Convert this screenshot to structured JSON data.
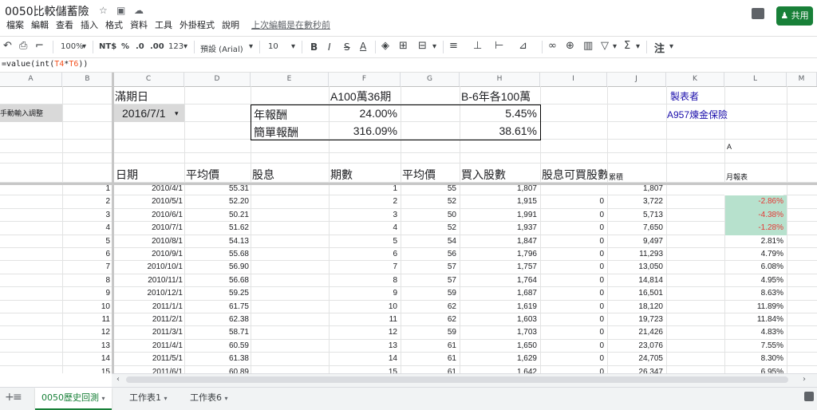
{
  "title_bar": {
    "doc_title": "0050比較儲蓄險",
    "menus": [
      "檔案",
      "編輯",
      "查看",
      "插入",
      "格式",
      "資料",
      "工具",
      "外掛程式",
      "說明"
    ],
    "last_edit": "上次編輯是在數秒前",
    "share_label": "共用",
    "share_icon": "person-icon"
  },
  "toolbar": {
    "zoom": "100%",
    "currency": "NT$",
    "percent": "%",
    "dec_decrease": ".0",
    "dec_increase": ".00",
    "more_formats": "123",
    "font": "預設 (Arial)",
    "font_size": "10",
    "bold": "B",
    "italic": "I",
    "strike": "S",
    "text_color": "A",
    "sigma": "Σ",
    "note": "注"
  },
  "formula_bar": {
    "before": "=value(int(",
    "ref1": "T4",
    "mid": "*",
    "ref2": "T6",
    "after": "))"
  },
  "columns": [
    "A",
    "B",
    "C",
    "D",
    "E",
    "F",
    "G",
    "H",
    "I",
    "J",
    "K",
    "L",
    "M"
  ],
  "sheet": {
    "b1": "滿期日",
    "a2": "手動輸入調整",
    "b2": "2016/7/1",
    "e1": "A100萬36期",
    "g1": "B-6年各100萬",
    "j1": "製表者",
    "j2": "A957煉金保險",
    "d2": "年報酬",
    "f2": "24.00%",
    "h2": "5.45%",
    "d3": "簡單報酬",
    "f3": "316.09%",
    "h3": "38.61%",
    "l4": "A",
    "headers": {
      "date": "日期",
      "avg_price": "平均價",
      "dividend": "股息",
      "periods": "期數",
      "avg_price2": "平均價",
      "buy_shares": "買入股數",
      "div_shares": "股息可買股數",
      "cumulative": "累積",
      "monthly": "月報表"
    }
  },
  "rows": [
    {
      "n": "1",
      "date": "2010/4/1",
      "avg": "55.31",
      "periods": "1",
      "avg2": "55",
      "buy": "1,807",
      "div": "",
      "cum": "1,807",
      "monthly": ""
    },
    {
      "n": "2",
      "date": "2010/5/1",
      "avg": "52.20",
      "periods": "2",
      "avg2": "52",
      "buy": "1,915",
      "div": "0",
      "cum": "3,722",
      "monthly": "-2.86%"
    },
    {
      "n": "3",
      "date": "2010/6/1",
      "avg": "50.21",
      "periods": "3",
      "avg2": "50",
      "buy": "1,991",
      "div": "0",
      "cum": "5,713",
      "monthly": "-4.38%"
    },
    {
      "n": "4",
      "date": "2010/7/1",
      "avg": "51.62",
      "periods": "4",
      "avg2": "52",
      "buy": "1,937",
      "div": "0",
      "cum": "7,650",
      "monthly": "-1.28%"
    },
    {
      "n": "5",
      "date": "2010/8/1",
      "avg": "54.13",
      "periods": "5",
      "avg2": "54",
      "buy": "1,847",
      "div": "0",
      "cum": "9,497",
      "monthly": "2.81%"
    },
    {
      "n": "6",
      "date": "2010/9/1",
      "avg": "55.68",
      "periods": "6",
      "avg2": "56",
      "buy": "1,796",
      "div": "0",
      "cum": "11,293",
      "monthly": "4.79%"
    },
    {
      "n": "7",
      "date": "2010/10/1",
      "avg": "56.90",
      "periods": "7",
      "avg2": "57",
      "buy": "1,757",
      "div": "0",
      "cum": "13,050",
      "monthly": "6.08%"
    },
    {
      "n": "8",
      "date": "2010/11/1",
      "avg": "56.68",
      "periods": "8",
      "avg2": "57",
      "buy": "1,764",
      "div": "0",
      "cum": "14,814",
      "monthly": "4.95%"
    },
    {
      "n": "9",
      "date": "2010/12/1",
      "avg": "59.25",
      "periods": "9",
      "avg2": "59",
      "buy": "1,687",
      "div": "0",
      "cum": "16,501",
      "monthly": "8.63%"
    },
    {
      "n": "10",
      "date": "2011/1/1",
      "avg": "61.75",
      "periods": "10",
      "avg2": "62",
      "buy": "1,619",
      "div": "0",
      "cum": "18,120",
      "monthly": "11.89%"
    },
    {
      "n": "11",
      "date": "2011/2/1",
      "avg": "62.38",
      "periods": "11",
      "avg2": "62",
      "buy": "1,603",
      "div": "0",
      "cum": "19,723",
      "monthly": "11.84%"
    },
    {
      "n": "12",
      "date": "2011/3/1",
      "avg": "58.71",
      "periods": "12",
      "avg2": "59",
      "buy": "1,703",
      "div": "0",
      "cum": "21,426",
      "monthly": "4.83%"
    },
    {
      "n": "13",
      "date": "2011/4/1",
      "avg": "60.59",
      "periods": "13",
      "avg2": "61",
      "buy": "1,650",
      "div": "0",
      "cum": "23,076",
      "monthly": "7.55%"
    },
    {
      "n": "14",
      "date": "2011/5/1",
      "avg": "61.38",
      "periods": "14",
      "avg2": "61",
      "buy": "1,629",
      "div": "0",
      "cum": "24,705",
      "monthly": "8.30%"
    },
    {
      "n": "15",
      "date": "2011/6/1",
      "avg": "60.89",
      "periods": "15",
      "avg2": "61",
      "buy": "1,642",
      "div": "0",
      "cum": "26,347",
      "monthly": "6.95%"
    }
  ],
  "sheet_tabs": [
    "0050歷史回測",
    "工作表1",
    "工作表6"
  ],
  "colors": {
    "share_green": "#188038",
    "negative_red": "#e53935",
    "highlight_green": "#b7e1cd",
    "link_blue": "#1a0dab"
  }
}
